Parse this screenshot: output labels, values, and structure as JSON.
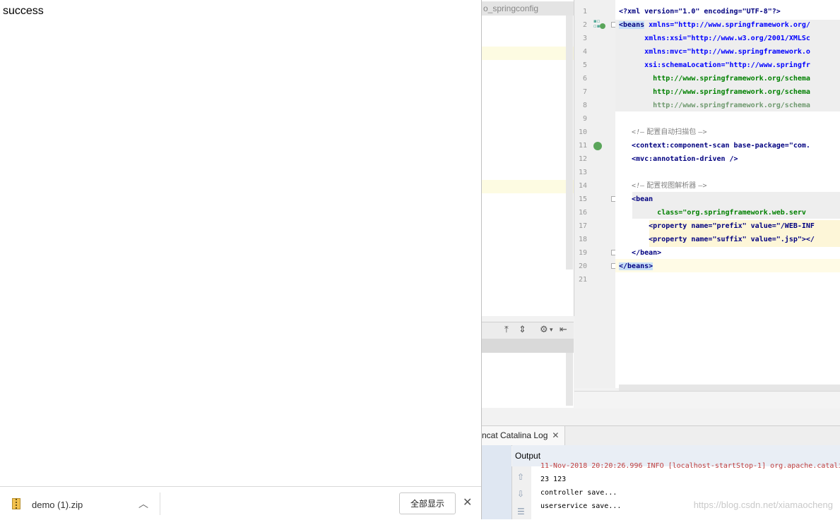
{
  "browser": {
    "page_text": "success",
    "download": {
      "file_name": "demo (1).zip",
      "show_all_label": "全部显示",
      "close_glyph": "✕",
      "chevron_glyph": "︿"
    }
  },
  "ide": {
    "project_tab": "o_springconfig",
    "editor": {
      "line_numbers": [
        "1",
        "2",
        "3",
        "4",
        "5",
        "6",
        "7",
        "8",
        "9",
        "10",
        "11",
        "12",
        "13",
        "14",
        "15",
        "16",
        "17",
        "18",
        "19",
        "20",
        "21"
      ],
      "lines": {
        "l1": "<?xml version=\"1.0\" encoding=\"UTF-8\"?>",
        "l2a": "<beans",
        "l2b": " xmlns=\"http://www.springframework.org/",
        "l3": "      xmlns:xsi=\"http://www.w3.org/2001/XMLSc",
        "l4": "      xmlns:mvc=\"http://www.springframework.o",
        "l5": "      xsi:schemaLocation=\"http://www.springfr",
        "l6": "        http://www.springframework.org/schema",
        "l7": "        http://www.springframework.org/schema",
        "l8": "        http://www.springframework.org/schema",
        "l10a": "   <!—",
        "l10b": " 配置自动扫描包 ",
        "l10c": "—>",
        "l11": "   <context:component-scan base-package=\"com.",
        "l12": "   <mvc:annotation-driven />",
        "l14a": "   <!—",
        "l14b": " 配置视图解析器 ",
        "l14c": "—>",
        "l15": "   <bean",
        "l16": "         class=\"org.springframework.web.serv",
        "l17": "       <property name=\"prefix\" value=\"/WEB-INF",
        "l18": "       <property name=\"suffix\" value=\".jsp\"></",
        "l19": "   </bean>",
        "l20": "</beans>"
      }
    },
    "run": {
      "tab_label": "ncat Catalina Log",
      "tab_close": "✕",
      "output_label": "Output",
      "console_lines": [
        "11-Nov-2018 20:20:26.996 INFO [localhost-startStop-1] org.apache.catali",
        "23 123",
        "controller save...",
        "userservice save..."
      ]
    }
  },
  "watermark": "https://blog.csdn.net/xiamaocheng"
}
